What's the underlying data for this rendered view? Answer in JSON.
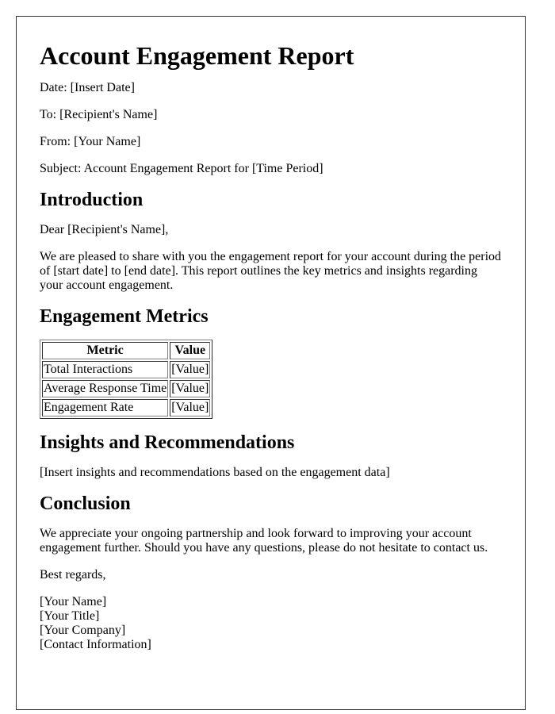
{
  "title": "Account Engagement Report",
  "header_fields": [
    {
      "label": "Date:",
      "value": "[Insert Date]"
    },
    {
      "label": "To:",
      "value": "[Recipient's Name]"
    },
    {
      "label": "From:",
      "value": "[Your Name]"
    },
    {
      "label": "Subject:",
      "value": "Account Engagement Report for [Time Period]"
    }
  ],
  "introduction": {
    "heading": "Introduction",
    "salutation": "Dear [Recipient's Name],",
    "body": "We are pleased to share with you the engagement report for your account during the period of [start date] to [end date]. This report outlines the key metrics and insights regarding your account engagement."
  },
  "metrics": {
    "heading": "Engagement Metrics",
    "columns": [
      "Metric",
      "Value"
    ],
    "rows": [
      [
        "Total Interactions",
        "[Value]"
      ],
      [
        "Average Response Time",
        "[Value]"
      ],
      [
        "Engagement Rate",
        "[Value]"
      ]
    ]
  },
  "insights": {
    "heading": "Insights and Recommendations",
    "body": "[Insert insights and recommendations based on the engagement data]"
  },
  "conclusion": {
    "heading": "Conclusion",
    "body": "We appreciate your ongoing partnership and look forward to improving your account engagement further. Should you have any questions, please do not hesitate to contact us.",
    "closing": "Best regards,",
    "signature": [
      "[Your Name]",
      "[Your Title]",
      "[Your Company]",
      "[Contact Information]"
    ]
  }
}
